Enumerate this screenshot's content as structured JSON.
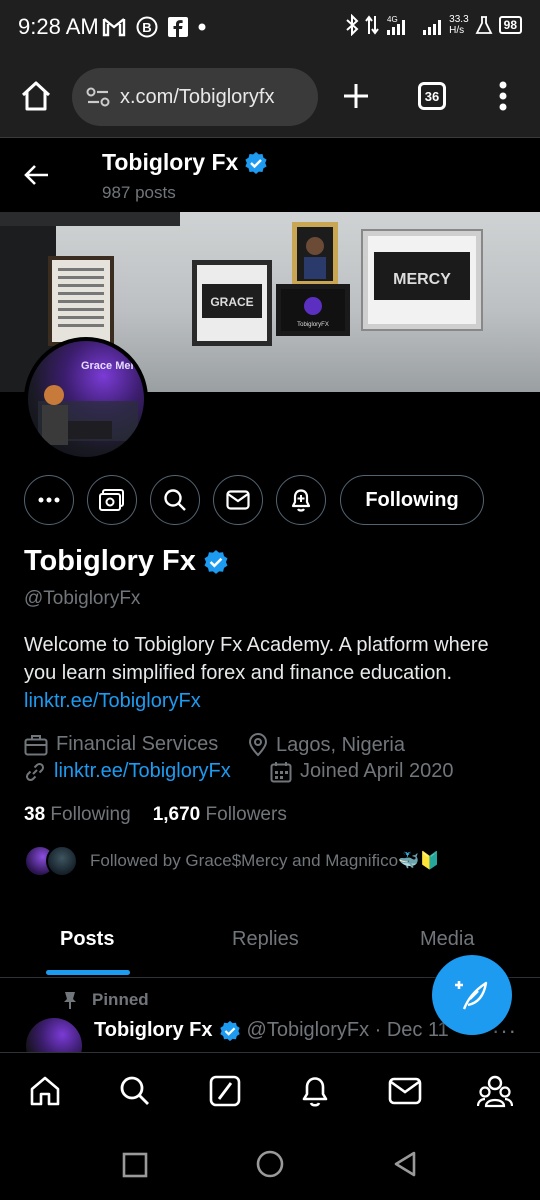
{
  "status_bar": {
    "time": "9:28 AM",
    "net_speed_value": "33.3",
    "net_speed_unit": "H/s",
    "battery": "98",
    "signal": "4G"
  },
  "browser": {
    "url": "x.com/Tobigloryfx",
    "tab_count": "36"
  },
  "header": {
    "name": "Tobiglory Fx",
    "post_count": "987 posts"
  },
  "banner": {
    "frame_left": "GRACE",
    "frame_right": "MERCY",
    "frame_center": "TobigloryFX"
  },
  "avatar_text": "Grace Mercy",
  "actions": {
    "following_label": "Following"
  },
  "profile": {
    "name": "Tobiglory Fx",
    "handle": "@TobigloryFx",
    "bio_text": "Welcome to Tobiglory Fx Academy. A platform where you learn simplified forex and finance education. ",
    "bio_link": "linktr.ee/TobigloryFx",
    "category": "Financial Services",
    "location": "Lagos, Nigeria",
    "website": "linktr.ee/TobigloryFx",
    "joined": "Joined April 2020"
  },
  "stats": {
    "following_count": "38",
    "following_label": "Following",
    "followers_count": "1,670",
    "followers_label": "Followers"
  },
  "followed_by": "Followed by Grace$Mercy and Magnifico🐳🔰",
  "tabs": {
    "posts": "Posts",
    "replies": "Replies",
    "media": "Media"
  },
  "pinned_post": {
    "pinned_label": "Pinned",
    "name": "Tobiglory Fx",
    "meta": "@TobigloryFx · Dec 11",
    "more": "···"
  },
  "colors": {
    "accent": "#1d9bf0",
    "background": "#000000",
    "secondary_text": "#71767b"
  }
}
